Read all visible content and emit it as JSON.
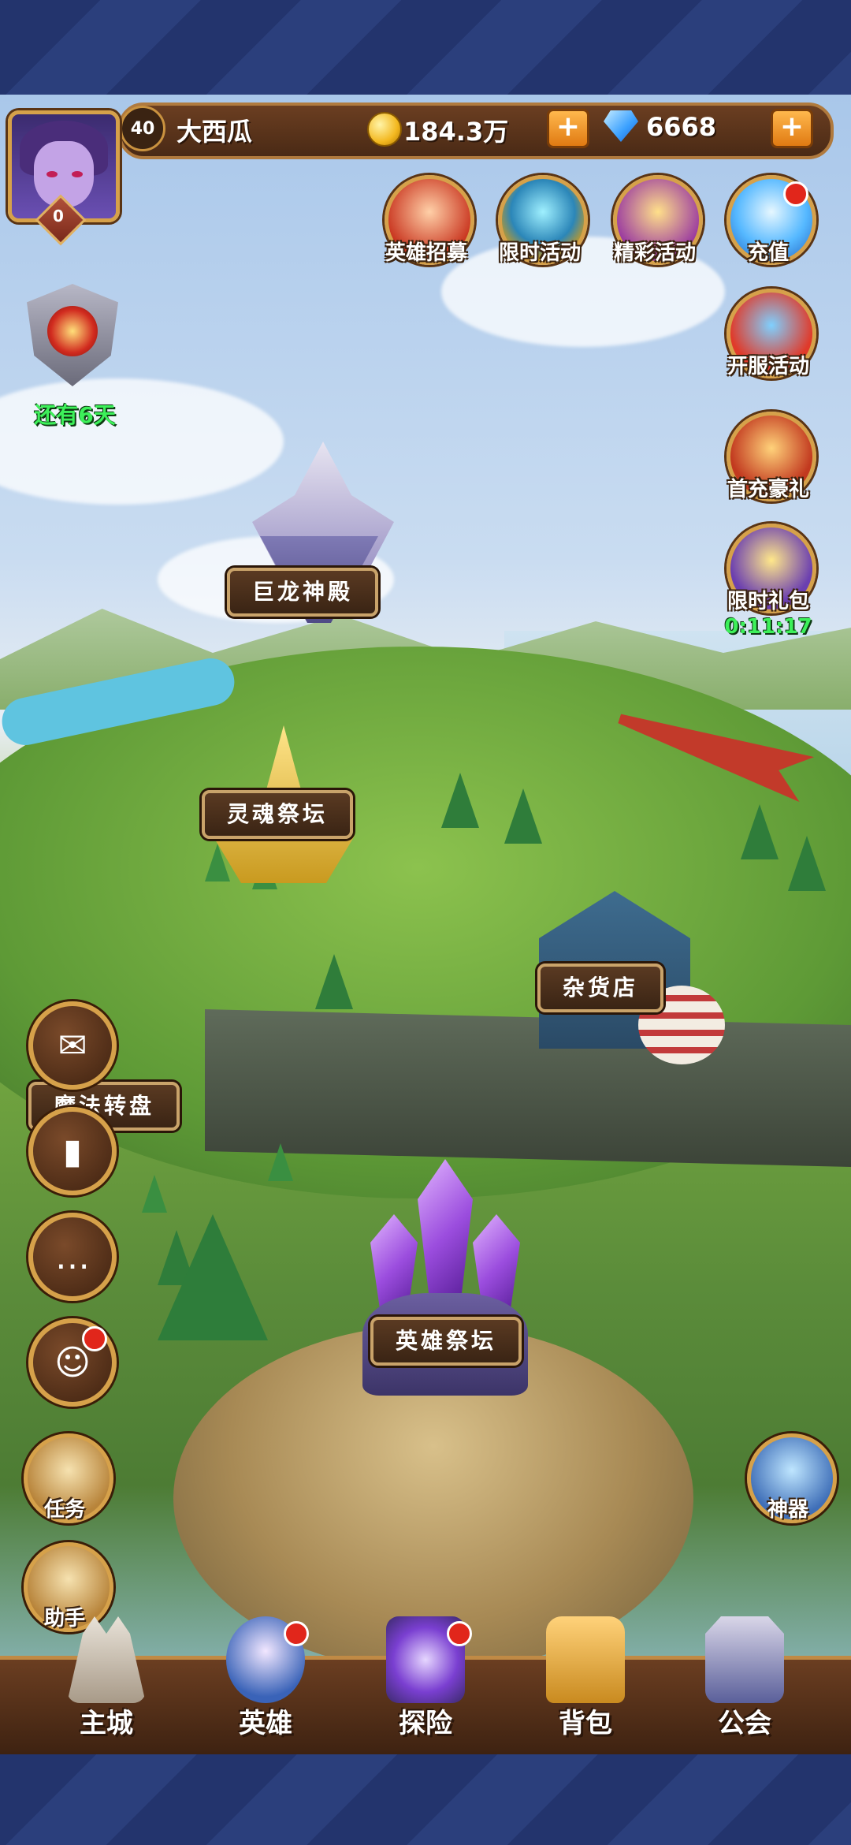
{
  "player": {
    "level": "40",
    "name": "大西瓜",
    "vip": "0"
  },
  "currency": {
    "gold": "184.3万",
    "gems": "6668",
    "plus": "+"
  },
  "event": {
    "timer": "还有6天"
  },
  "top_icons": [
    {
      "label": "英雄招募"
    },
    {
      "label": "限时活动"
    },
    {
      "label": "精彩活动"
    },
    {
      "label": "充值"
    }
  ],
  "right_icons": [
    {
      "label": "开服活动"
    },
    {
      "label": "首充豪礼"
    },
    {
      "label": "限时礼包",
      "timer": "0:11:17"
    }
  ],
  "buildings": {
    "dragon_temple": "巨龙神殿",
    "soul_altar": "灵魂祭坛",
    "shop": "杂货店",
    "magic_wheel": "魔法转盘",
    "hero_altar": "英雄祭坛"
  },
  "quick": {
    "tasks": "任务",
    "assistant": "助手",
    "artifact": "神器"
  },
  "nav": {
    "city": "主城",
    "heroes": "英雄",
    "explore": "探险",
    "bag": "背包",
    "guild": "公会"
  },
  "colors": {
    "accent_gold": "#d6a14a",
    "wood": "#5a3414",
    "timer_green": "#3df05a",
    "alert_red": "#e1261b"
  }
}
